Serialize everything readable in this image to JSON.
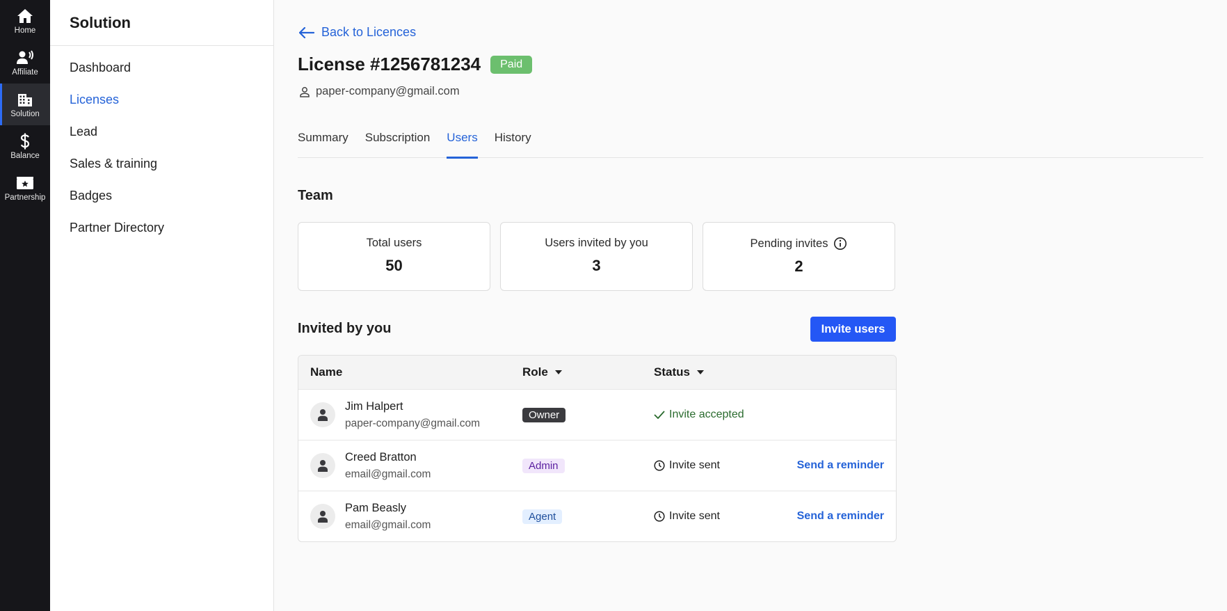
{
  "rail": [
    {
      "label": "Home",
      "icon": "home-icon"
    },
    {
      "label": "Affiliate",
      "icon": "affiliate-icon"
    },
    {
      "label": "Solution",
      "icon": "building-icon",
      "active": true
    },
    {
      "label": "Balance",
      "icon": "dollar-icon"
    },
    {
      "label": "Partnership",
      "icon": "partnership-icon"
    }
  ],
  "sidenav": {
    "title": "Solution",
    "items": [
      "Dashboard",
      "Licenses",
      "Lead",
      "Sales & training",
      "Badges",
      "Partner Directory"
    ]
  },
  "header": {
    "back_label": "Back to Licences",
    "title": "License #1256781234",
    "status_badge": "Paid",
    "owner_email": "paper-company@gmail.com"
  },
  "tabs": [
    "Summary",
    "Subscription",
    "Users",
    "History"
  ],
  "team": {
    "heading": "Team",
    "cards": [
      {
        "label": "Total users",
        "value": "50"
      },
      {
        "label": "Users invited by you",
        "value": "3"
      },
      {
        "label": "Pending invites",
        "value": "2"
      }
    ]
  },
  "invited": {
    "heading": "Invited by you",
    "invite_button": "Invite users",
    "columns": {
      "name": "Name",
      "role": "Role",
      "status": "Status"
    },
    "rows": [
      {
        "name": "Jim Halpert",
        "email": "paper-company@gmail.com",
        "role": "Owner",
        "status": "Invite accepted",
        "action": ""
      },
      {
        "name": "Creed Bratton",
        "email": "email@gmail.com",
        "role": "Admin",
        "status": "Invite sent",
        "action": "Send a reminder"
      },
      {
        "name": "Pam Beasly",
        "email": "email@gmail.com",
        "role": "Agent",
        "status": "Invite sent",
        "action": "Send a reminder"
      }
    ]
  },
  "colors": {
    "accent": "#2563d8",
    "button": "#2457f5",
    "paid": "#6cbf6e",
    "rail": "#16161a"
  }
}
